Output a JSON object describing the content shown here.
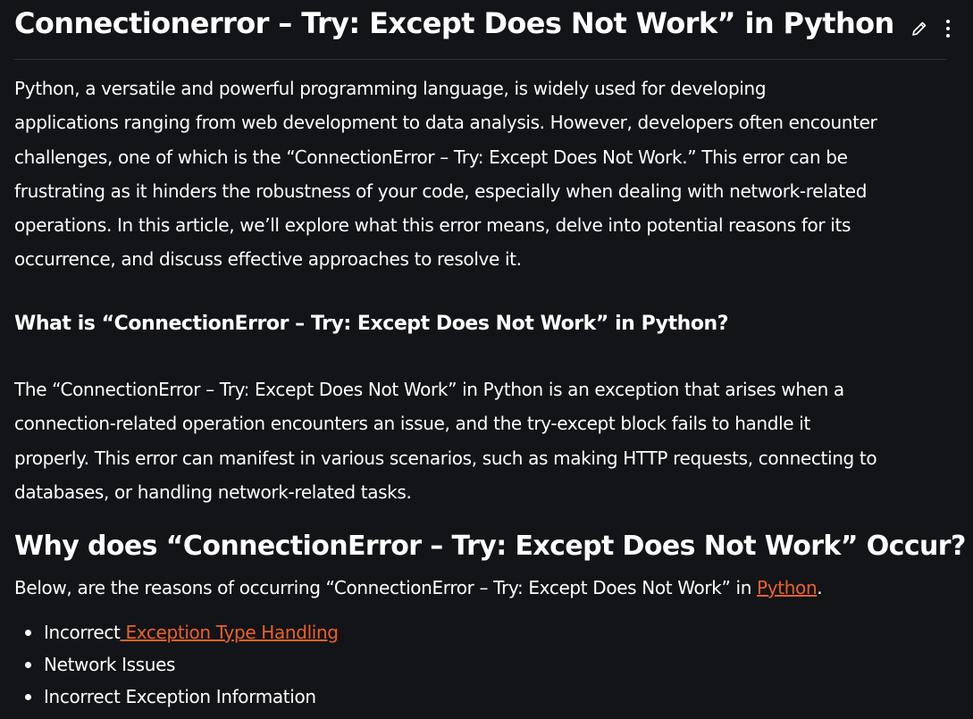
{
  "article": {
    "title": "Connectionerror – Try: Except Does Not Work” in Python",
    "actions": {
      "edit_icon": "pencil-icon",
      "more_icon": "more-vertical-icon"
    },
    "intro_lines": [
      "Python, a versatile and powerful programming language, is widely used for developing",
      "applications ranging from web development to data analysis. However, developers often encounter",
      "challenges, one of which is the “ConnectionError – Try: Except Does Not Work.” This error can be",
      "frustrating as it hinders the robustness of your code, especially when dealing with network-related",
      "operations. In this article, we’ll explore what this error means, delve into potential reasons for its",
      "occurrence, and discuss effective approaches to resolve it."
    ],
    "section1": {
      "heading": "What is “ConnectionError – Try: Except Does Not Work” in Python?",
      "lines": [
        "The “ConnectionError – Try: Except Does Not Work” in Python is an exception that arises when a",
        "connection-related operation encounters an issue, and the try-except block fails to handle it",
        "properly. This error can manifest in various scenarios, such as making HTTP requests, connecting to",
        "databases, or handling network-related tasks."
      ]
    },
    "section2": {
      "heading": "Why does “ConnectionError – Try: Except Does Not Work” Occur?",
      "intro_prefix": "Below, are the reasons of occurring “ConnectionError – Try: Except Does Not Work” in ",
      "intro_link": "Python",
      "intro_suffix": ".",
      "items": [
        {
          "prefix": "Incorrect",
          "link": " Exception Type Handling"
        },
        {
          "prefix": "Network Issues",
          "link": ""
        },
        {
          "prefix": "Incorrect Exception Information",
          "link": ""
        }
      ]
    },
    "colors": {
      "background": "#131417",
      "text": "#ffffff",
      "link": "#e8612c",
      "divider": "#2f3238"
    }
  }
}
